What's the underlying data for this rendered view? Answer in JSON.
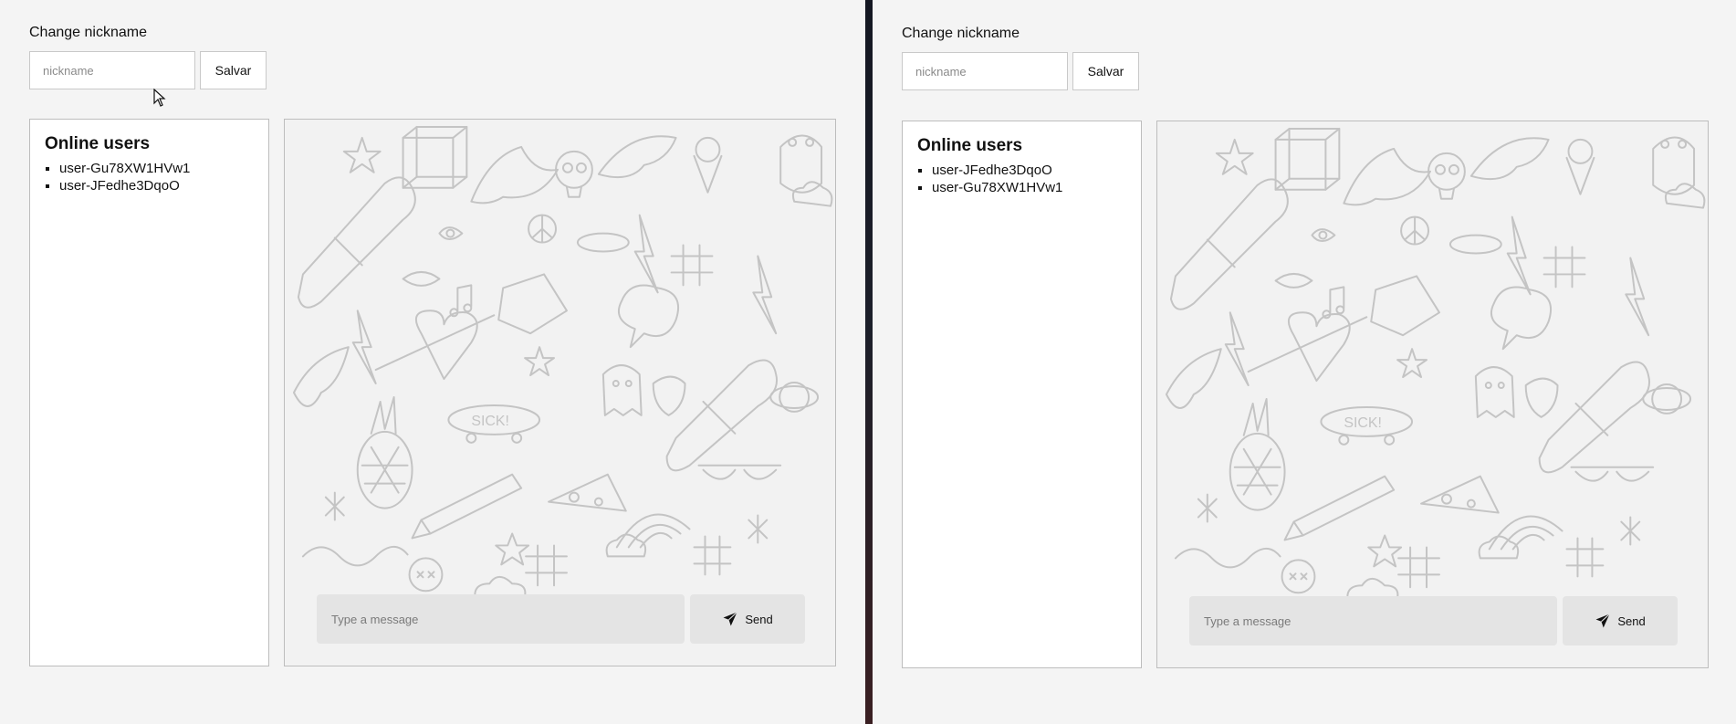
{
  "left": {
    "nickname": {
      "heading": "Change nickname",
      "placeholder": "nickname",
      "save_label": "Salvar"
    },
    "online": {
      "title": "Online users",
      "users": [
        "user-Gu78XW1HVw1",
        "user-JFedhe3DqoO"
      ]
    },
    "chat": {
      "placeholder": "Type a message",
      "send_label": "Send",
      "send_icon": "paper-plane-icon"
    }
  },
  "right": {
    "nickname": {
      "heading": "Change nickname",
      "placeholder": "nickname",
      "save_label": "Salvar"
    },
    "online": {
      "title": "Online users",
      "users": [
        "user-JFedhe3DqoO",
        "user-Gu78XW1HVw1"
      ]
    },
    "chat": {
      "placeholder": "Type a message",
      "send_label": "Send",
      "send_icon": "paper-plane-icon"
    }
  },
  "colors": {
    "background": "#f4f4f4",
    "divider": "#1c1f2a",
    "doodle_stroke": "#c4c4c4",
    "input_fill": "#e4e4e4"
  }
}
